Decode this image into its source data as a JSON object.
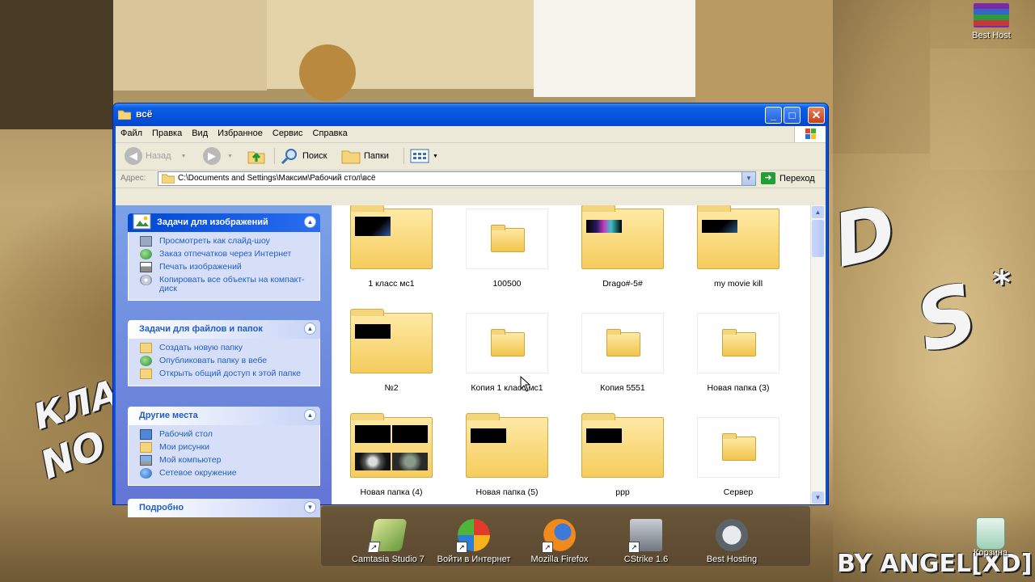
{
  "window": {
    "title": "всё",
    "menu": [
      "Файл",
      "Правка",
      "Вид",
      "Избранное",
      "Сервис",
      "Справка"
    ],
    "toolbar": {
      "back_label": "Назад",
      "search_label": "Поиск",
      "folders_label": "Папки"
    },
    "address": {
      "label": "Адрес:",
      "value": "C:\\Documents and Settings\\Максим\\Рабочий стол\\всё",
      "go_label": "Переход"
    }
  },
  "left_pane": {
    "image_tasks": {
      "title": "Задачи для изображений",
      "items": [
        "Просмотреть как слайд-шоу",
        "Заказ отпечатков через Интернет",
        "Печать изображений",
        "Копировать все объекты на компакт-диск"
      ]
    },
    "file_tasks": {
      "title": "Задачи для файлов и папок",
      "items": [
        "Создать новую папку",
        "Опубликовать папку в вебе",
        "Открыть общий доступ к этой папке"
      ]
    },
    "other_places": {
      "title": "Другие места",
      "items": [
        "Рабочий стол",
        "Мои рисунки",
        "Мой компьютер",
        "Сетевое окружение"
      ]
    },
    "details": {
      "title": "Подробно"
    }
  },
  "folders": [
    "1 класс мс1",
    "100500",
    "Drago#-5#",
    "my movie kill",
    "№2",
    "Копия 1 класс мс1",
    "Копия 5551",
    "Новая папка (3)",
    "Новая папка (4)",
    "Новая папка (5)",
    "ррр",
    "Сервер"
  ],
  "desktop": {
    "top_right_icon": "Best Host",
    "recycle_bin": "Корзина",
    "dock": [
      "Camtasia Studio 7",
      "Войти в Интернет",
      "Mozilla Firefox",
      "CStrike 1.6",
      "Best Hosting"
    ]
  }
}
